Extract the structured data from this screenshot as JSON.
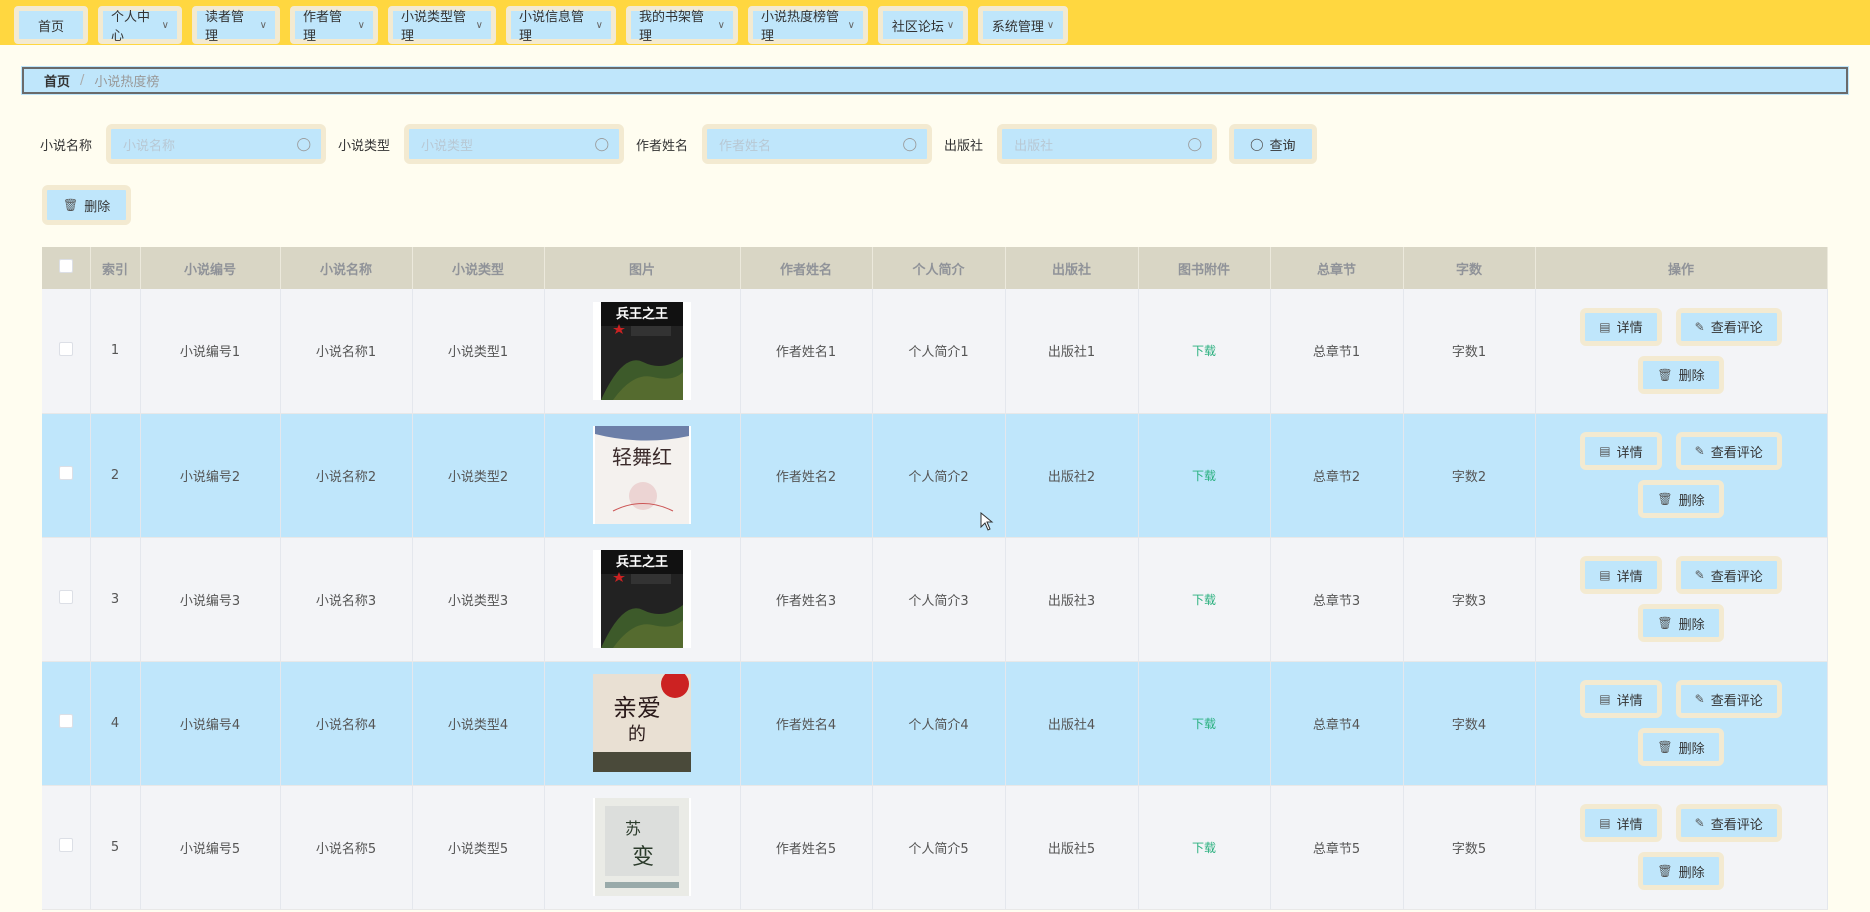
{
  "nav": [
    {
      "label": "首页",
      "has_dropdown": false
    },
    {
      "label": "个人中心",
      "has_dropdown": true
    },
    {
      "label": "读者管理",
      "has_dropdown": true
    },
    {
      "label": "作者管理",
      "has_dropdown": true
    },
    {
      "label": "小说类型管理",
      "has_dropdown": true
    },
    {
      "label": "小说信息管理",
      "has_dropdown": true
    },
    {
      "label": "我的书架管理",
      "has_dropdown": true
    },
    {
      "label": "小说热度榜管理",
      "has_dropdown": true
    },
    {
      "label": "社区论坛",
      "has_dropdown": true
    },
    {
      "label": "系统管理",
      "has_dropdown": true
    }
  ],
  "breadcrumb": {
    "home": "首页",
    "separator": "/",
    "current": "小说热度榜"
  },
  "search": {
    "fields": [
      {
        "label": "小说名称",
        "placeholder": "小说名称"
      },
      {
        "label": "小说类型",
        "placeholder": "小说类型"
      },
      {
        "label": "作者姓名",
        "placeholder": "作者姓名"
      },
      {
        "label": "出版社",
        "placeholder": "出版社"
      }
    ],
    "query_label": "查询"
  },
  "toolbar": {
    "delete_label": "删除"
  },
  "table": {
    "columns": [
      "索引",
      "小说编号",
      "小说名称",
      "小说类型",
      "图片",
      "作者姓名",
      "个人简介",
      "出版社",
      "图书附件",
      "总章节",
      "字数",
      "操作"
    ],
    "rows": [
      {
        "index": "1",
        "no": "小说编号1",
        "name": "小说名称1",
        "type": "小说类型1",
        "cover": "cover-a",
        "author": "作者姓名1",
        "bio": "个人简介1",
        "publisher": "出版社1",
        "attachment": "下载",
        "chapters": "总章节1",
        "words": "字数1"
      },
      {
        "index": "2",
        "no": "小说编号2",
        "name": "小说名称2",
        "type": "小说类型2",
        "cover": "cover-b",
        "author": "作者姓名2",
        "bio": "个人简介2",
        "publisher": "出版社2",
        "attachment": "下载",
        "chapters": "总章节2",
        "words": "字数2"
      },
      {
        "index": "3",
        "no": "小说编号3",
        "name": "小说名称3",
        "type": "小说类型3",
        "cover": "cover-a",
        "author": "作者姓名3",
        "bio": "个人简介3",
        "publisher": "出版社3",
        "attachment": "下载",
        "chapters": "总章节3",
        "words": "字数3"
      },
      {
        "index": "4",
        "no": "小说编号4",
        "name": "小说名称4",
        "type": "小说类型4",
        "cover": "cover-c",
        "author": "作者姓名4",
        "bio": "个人简介4",
        "publisher": "出版社4",
        "attachment": "下载",
        "chapters": "总章节4",
        "words": "字数4"
      },
      {
        "index": "5",
        "no": "小说编号5",
        "name": "小说名称5",
        "type": "小说类型5",
        "cover": "cover-d",
        "author": "作者姓名5",
        "bio": "个人简介5",
        "publisher": "出版社5",
        "attachment": "下载",
        "chapters": "总章节5",
        "words": "字数5"
      }
    ],
    "actions": {
      "detail": "详情",
      "comments": "查看评论",
      "delete": "删除"
    }
  },
  "colors": {
    "topbar": "#ffd740",
    "accent": "#bfe6fb",
    "button_border": "#f3ead1",
    "header_bg": "#d9d6c5",
    "download": "#2ab07f",
    "page_bg": "#fffdf0"
  }
}
